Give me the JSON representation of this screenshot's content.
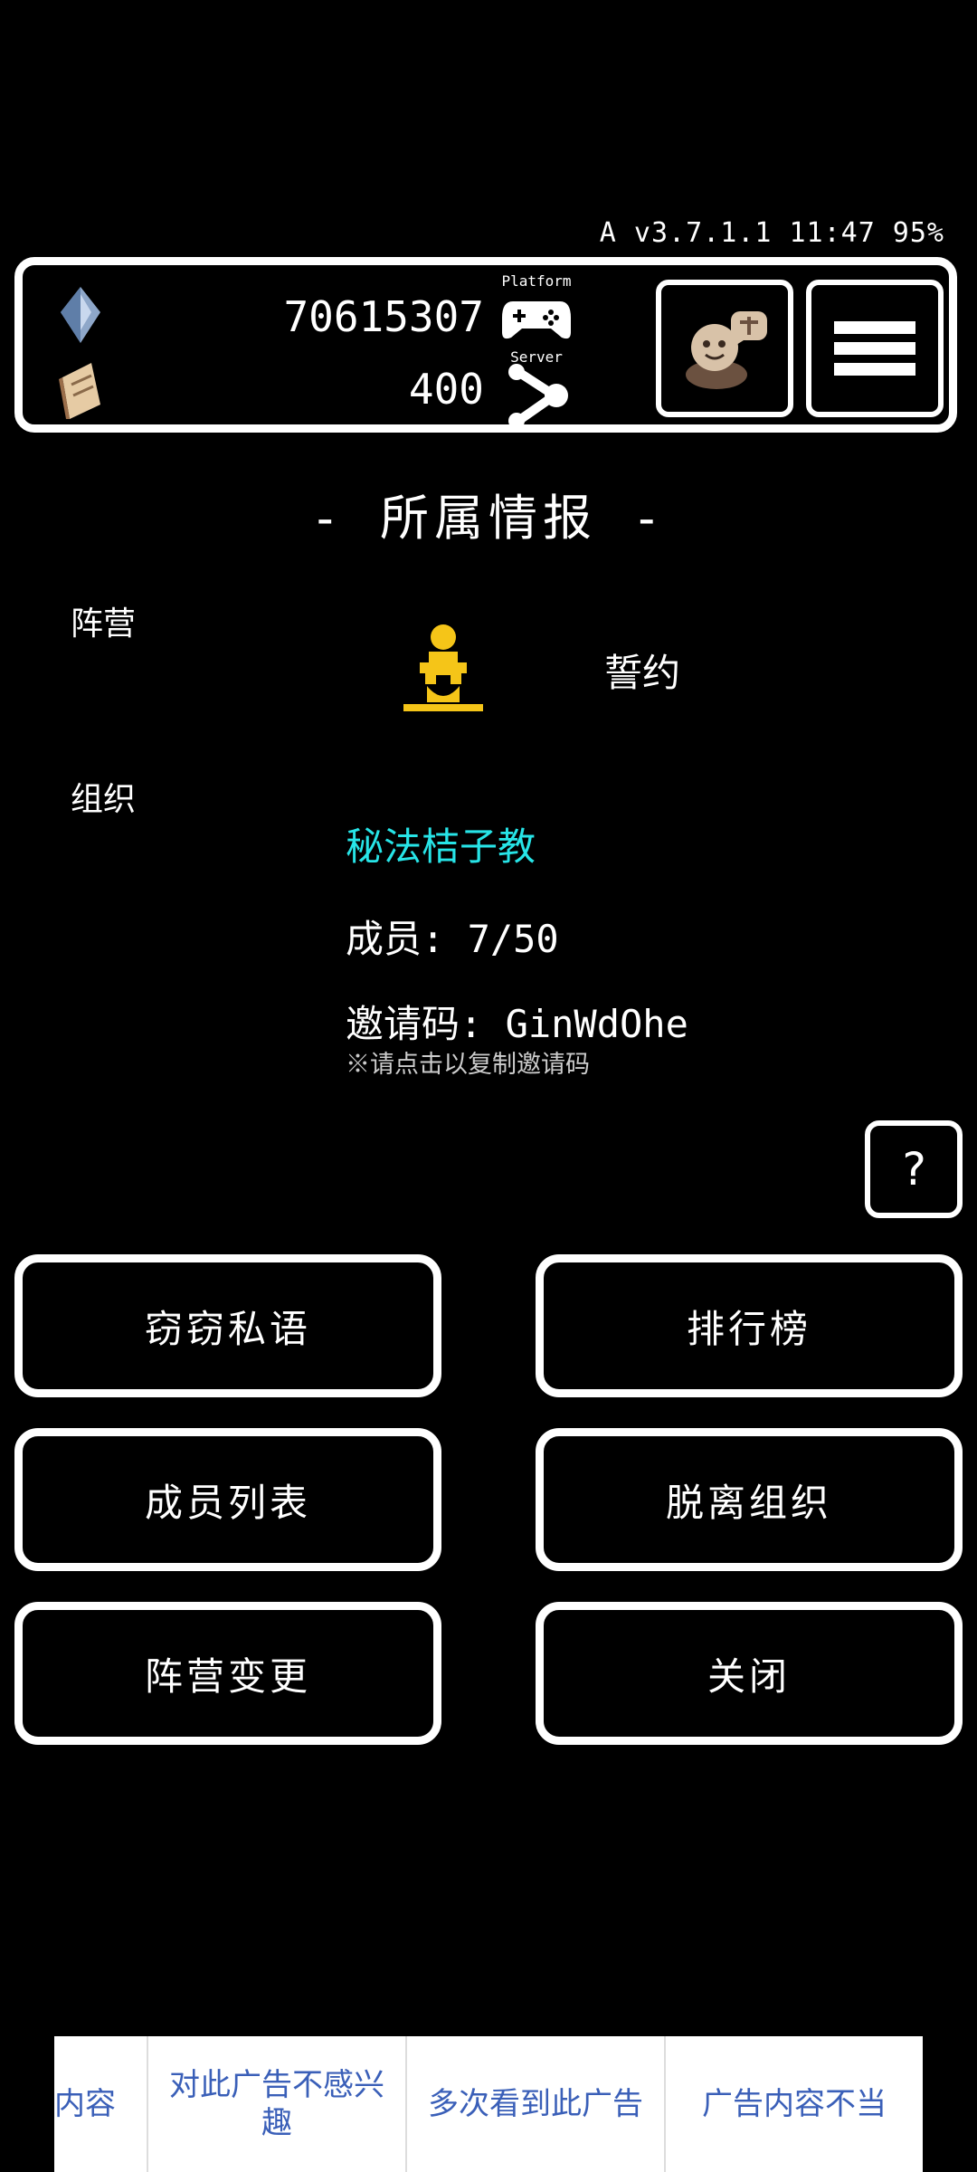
{
  "status_bar": {
    "text": "A v3.7.1.1 11:47 95%"
  },
  "header": {
    "gems": "70615307",
    "scrolls": "400",
    "platform_label": "Platform",
    "server_label": "Server"
  },
  "section": {
    "title": "- 所属情报 -"
  },
  "camp": {
    "label": "阵营",
    "value": "誓约",
    "icon_color": "#f5c518"
  },
  "organization": {
    "label": "组织",
    "name": "秘法桔子教",
    "name_color": "#27e4e7",
    "members": "成员: 7/50",
    "invite": "邀请码: GinWdOhe",
    "copy_hint": "※请点击以复制邀请码"
  },
  "help": {
    "label": "?"
  },
  "buttons": {
    "whisper": "窃窃私语",
    "ranking": "排行榜",
    "member_list": "成员列表",
    "leave": "脱离组织",
    "camp_change": "阵营变更",
    "close": "关闭"
  },
  "ad_feedback": {
    "options": [
      "内容",
      "对此广告不感兴趣",
      "多次看到此广告",
      "广告内容不当"
    ]
  }
}
